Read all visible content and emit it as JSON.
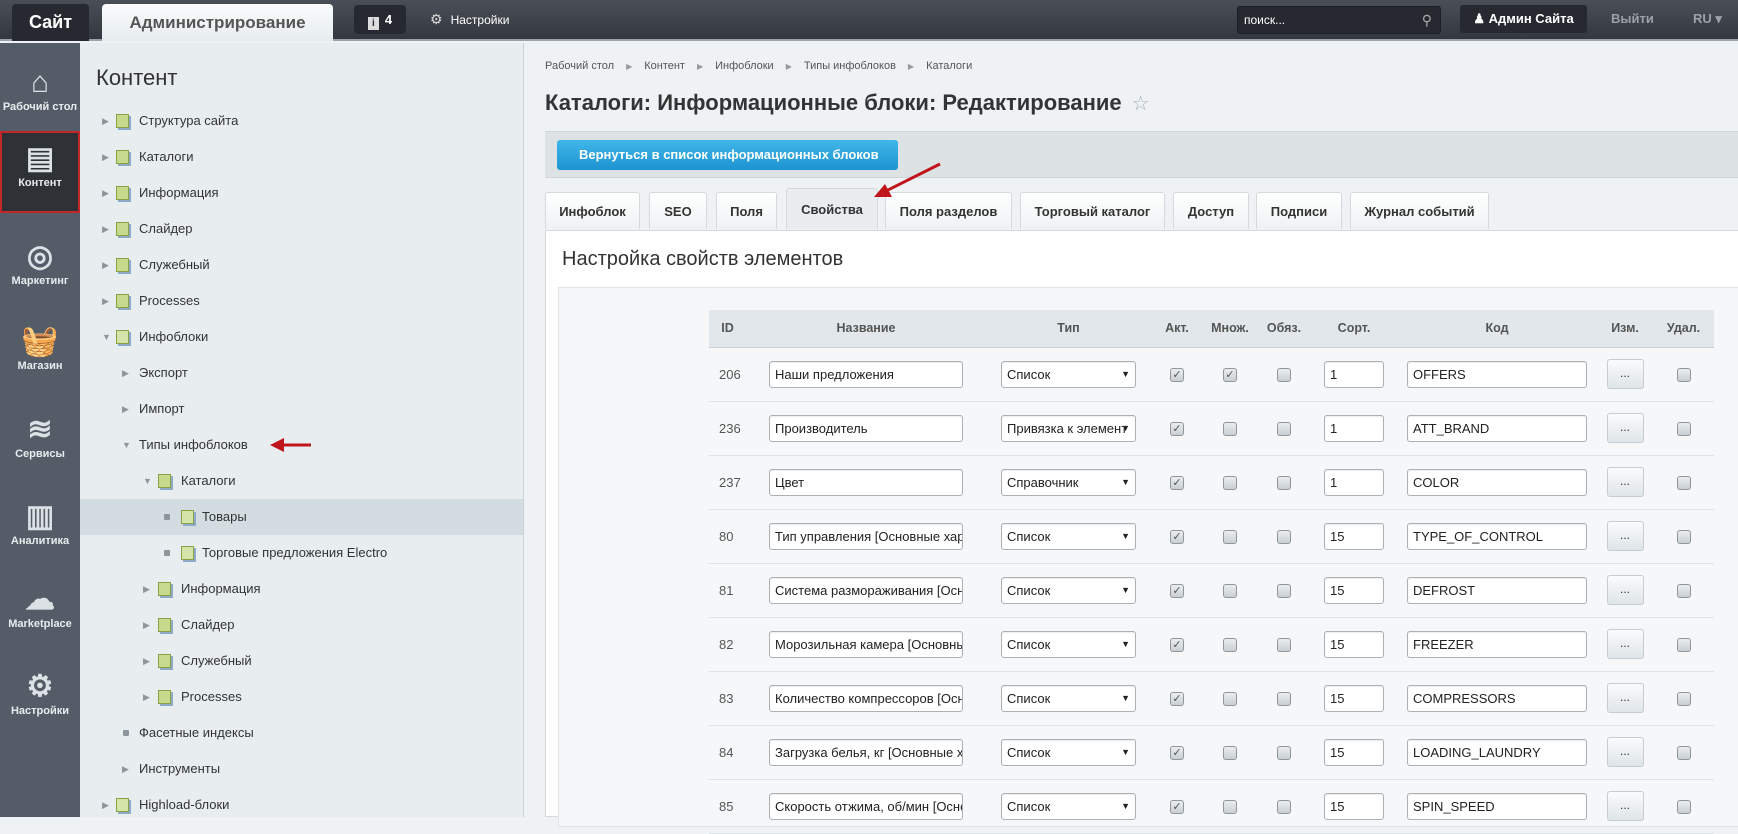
{
  "topbar": {
    "site_tab": "Сайт",
    "admin_tab": "Администрирование",
    "notifications_count": "4",
    "settings": "Настройки",
    "search_placeholder": "поиск...",
    "user": "Админ Сайта",
    "logout": "Выйти",
    "lang": "RU"
  },
  "iconbar": [
    {
      "label": "Рабочий стол",
      "icon": "home-icon"
    },
    {
      "label": "Контент",
      "icon": "document-icon",
      "active": true
    },
    {
      "label": "Маркетинг",
      "icon": "target-icon"
    },
    {
      "label": "Магазин",
      "icon": "basket-icon"
    },
    {
      "label": "Сервисы",
      "icon": "layers-icon"
    },
    {
      "label": "Аналитика",
      "icon": "bar-chart-icon"
    },
    {
      "label": "Marketplace",
      "icon": "cloud-download-icon"
    },
    {
      "label": "Настройки",
      "icon": "gear-icon"
    }
  ],
  "tree": {
    "title": "Контент",
    "items": [
      {
        "label": "Структура сайта",
        "level": 0,
        "state": "collapsed",
        "icon": "structure"
      },
      {
        "label": "Каталоги",
        "level": 0,
        "state": "collapsed",
        "icon": "folder"
      },
      {
        "label": "Информация",
        "level": 0,
        "state": "collapsed",
        "icon": "folder"
      },
      {
        "label": "Слайдер",
        "level": 0,
        "state": "collapsed",
        "icon": "folder"
      },
      {
        "label": "Служебный",
        "level": 0,
        "state": "collapsed",
        "icon": "folder"
      },
      {
        "label": "Processes",
        "level": 0,
        "state": "collapsed",
        "icon": "folder"
      },
      {
        "label": "Инфоблоки",
        "level": 0,
        "state": "expanded",
        "icon": "gear"
      },
      {
        "label": "Экспорт",
        "level": 1,
        "state": "collapsed",
        "icon": ""
      },
      {
        "label": "Импорт",
        "level": 1,
        "state": "collapsed",
        "icon": ""
      },
      {
        "label": "Типы инфоблоков",
        "level": 1,
        "state": "expanded",
        "icon": ""
      },
      {
        "label": "Каталоги",
        "level": 2,
        "state": "expanded",
        "icon": "folder"
      },
      {
        "label": "Товары",
        "level": 3,
        "state": "leaf",
        "icon": "gear",
        "selected": true
      },
      {
        "label": "Торговые предложения Electro",
        "level": 3,
        "state": "leaf",
        "icon": "gear"
      },
      {
        "label": "Информация",
        "level": 2,
        "state": "collapsed",
        "icon": "folder"
      },
      {
        "label": "Слайдер",
        "level": 2,
        "state": "collapsed",
        "icon": "folder"
      },
      {
        "label": "Служебный",
        "level": 2,
        "state": "collapsed",
        "icon": "folder"
      },
      {
        "label": "Processes",
        "level": 2,
        "state": "collapsed",
        "icon": "folder"
      },
      {
        "label": "Фасетные индексы",
        "level": 1,
        "state": "leaf",
        "icon": ""
      },
      {
        "label": "Инструменты",
        "level": 1,
        "state": "collapsed",
        "icon": ""
      },
      {
        "label": "Highload-блоки",
        "level": 0,
        "state": "collapsed",
        "icon": "gear"
      }
    ]
  },
  "breadcrumbs": [
    "Рабочий стол",
    "Контент",
    "Инфоблоки",
    "Типы инфоблоков",
    "Каталоги"
  ],
  "page_title": "Каталоги: Информационные блоки: Редактирование",
  "back_button": "Вернуться в список информационных блоков",
  "tabs": [
    "Инфоблок",
    "SEO",
    "Поля",
    "Свойства",
    "Поля разделов",
    "Торговый каталог",
    "Доступ",
    "Подписи",
    "Журнал событий"
  ],
  "active_tab": "Свойства",
  "panel_title": "Настройка свойств элементов",
  "table": {
    "headers": [
      "ID",
      "Название",
      "Тип",
      "Акт.",
      "Множ.",
      "Обяз.",
      "Сорт.",
      "Код",
      "Изм.",
      "Удал."
    ],
    "edit_label": "...",
    "rows": [
      {
        "id": "206",
        "name": "Наши предложения",
        "type": "Список",
        "active": true,
        "multiple": true,
        "required": false,
        "sort": "1",
        "code": "OFFERS",
        "delete": false
      },
      {
        "id": "236",
        "name": "Производитель",
        "type": "Привязка к элемент",
        "active": true,
        "multiple": false,
        "required": false,
        "sort": "1",
        "code": "ATT_BRAND",
        "delete": false
      },
      {
        "id": "237",
        "name": "Цвет",
        "type": "Справочник",
        "active": true,
        "multiple": false,
        "required": false,
        "sort": "1",
        "code": "COLOR",
        "delete": false
      },
      {
        "id": "80",
        "name": "Тип управления [Основные харак",
        "type": "Список",
        "active": true,
        "multiple": false,
        "required": false,
        "sort": "15",
        "code": "TYPE_OF_CONTROL",
        "delete": false
      },
      {
        "id": "81",
        "name": "Система размораживания [Основ",
        "type": "Список",
        "active": true,
        "multiple": false,
        "required": false,
        "sort": "15",
        "code": "DEFROST",
        "delete": false
      },
      {
        "id": "82",
        "name": "Морозильная камера [Основные :",
        "type": "Список",
        "active": true,
        "multiple": false,
        "required": false,
        "sort": "15",
        "code": "FREEZER",
        "delete": false
      },
      {
        "id": "83",
        "name": "Количество компрессоров [Основ",
        "type": "Список",
        "active": true,
        "multiple": false,
        "required": false,
        "sort": "15",
        "code": "COMPRESSORS",
        "delete": false
      },
      {
        "id": "84",
        "name": "Загрузка белья, кг [Основные хар",
        "type": "Список",
        "active": true,
        "multiple": false,
        "required": false,
        "sort": "15",
        "code": "LOADING_LAUNDRY",
        "delete": false
      },
      {
        "id": "85",
        "name": "Скорость отжима, об/мин [Основ",
        "type": "Список",
        "active": true,
        "multiple": false,
        "required": false,
        "sort": "15",
        "code": "SPIN_SPEED",
        "delete": false
      }
    ]
  },
  "colors": {
    "accent_blue": "#1d94d2",
    "annotation_red": "#c0151b",
    "active_nav_outline": "#c0282a"
  }
}
